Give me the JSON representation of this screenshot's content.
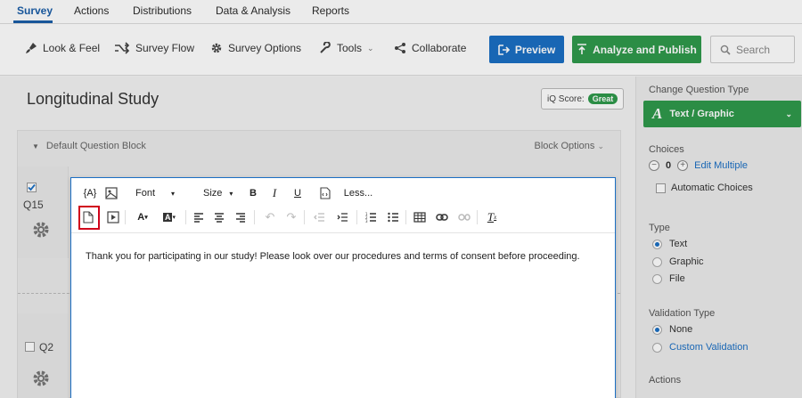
{
  "nav": {
    "tabs": [
      {
        "label": "Survey"
      },
      {
        "label": "Actions"
      },
      {
        "label": "Distributions"
      },
      {
        "label": "Data & Analysis"
      },
      {
        "label": "Reports"
      }
    ]
  },
  "toolbar": {
    "look_feel": "Look & Feel",
    "survey_flow": "Survey Flow",
    "survey_options": "Survey Options",
    "tools": "Tools",
    "collaborate": "Collaborate",
    "preview": "Preview",
    "publish": "Analyze and Publish",
    "search_placeholder": "Search"
  },
  "survey": {
    "title": "Longitudinal Study",
    "iq_score_label": "iQ Score:",
    "iq_score_value": "Great",
    "block_name": "Default Question Block",
    "block_options": "Block Options",
    "questions": [
      {
        "label": "Q15"
      },
      {
        "label": "Q2"
      }
    ]
  },
  "editor": {
    "font_label": "Font",
    "size_label": "Size",
    "bold": "B",
    "italic": "I",
    "underline": "U",
    "less": "Less...",
    "content": "Thank you for participating in our study! Please look over our procedures and terms of consent before proceeding."
  },
  "sidebar": {
    "change_question_type": "Change Question Type",
    "question_type": "Text / Graphic",
    "choices_heading": "Choices",
    "choices_count": "0",
    "edit_multiple": "Edit Multiple",
    "automatic_choices": "Automatic Choices",
    "type_heading": "Type",
    "type_options": [
      {
        "label": "Text",
        "selected": true
      },
      {
        "label": "Graphic",
        "selected": false
      },
      {
        "label": "File",
        "selected": false
      }
    ],
    "validation_heading": "Validation Type",
    "validation_options": [
      {
        "label": "None",
        "selected": true
      },
      {
        "label": "Custom Validation",
        "selected": false
      }
    ],
    "actions_heading": "Actions"
  },
  "colors": {
    "accent_blue": "#1b6fc4",
    "publish_green": "#2f9a4b",
    "highlight_red": "#d0021b"
  }
}
